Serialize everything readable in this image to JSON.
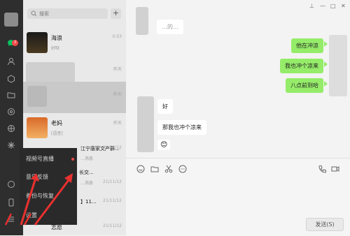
{
  "search": {
    "placeholder": "搜索",
    "add": "+"
  },
  "sidebar": {
    "badge": "3"
  },
  "conversations": [
    {
      "name": "海浪",
      "preview": "好呀",
      "time": "0:53"
    },
    {
      "name": "",
      "preview": "",
      "time": "昨天"
    },
    {
      "name": "",
      "preview": "",
      "time": "昨天"
    },
    {
      "name": "老妈",
      "preview": "[语音]",
      "time": "昨天"
    },
    {
      "name": "",
      "preview": "",
      "time": "21/11/12"
    },
    {
      "name": "",
      "preview": "",
      "time": "21/11/12"
    },
    {
      "name": "",
      "preview": "",
      "time": "21/11/12"
    },
    {
      "name": "",
      "preview": "",
      "time": "21/11/12"
    }
  ],
  "conv_extra": {
    "t4": "江宁唐家文产群...",
    "t4b": "…消息",
    "t5": "长交...",
    "t5b": "…消息",
    "t6": "】11...",
    "t7": "志愿"
  },
  "window": {
    "pin": "⊥",
    "min": "—",
    "max": "□",
    "close": "✕"
  },
  "messages": {
    "top_partial": "…的…",
    "m1": "他在冲凉",
    "m2": "我也冲个凉来",
    "m3": "八点前到哈",
    "m4": "好",
    "m5": "那我也冲个凉来",
    "m6": "😊"
  },
  "menu": {
    "items": [
      "视频号直播",
      "意见反馈",
      "备份与恢复",
      "设置"
    ]
  },
  "send_label": "发送(S)",
  "colors": {
    "accent": "#95ec69",
    "sidebar": "#2e2e2e",
    "badge": "#f04848",
    "arrow": "#e8312f"
  }
}
